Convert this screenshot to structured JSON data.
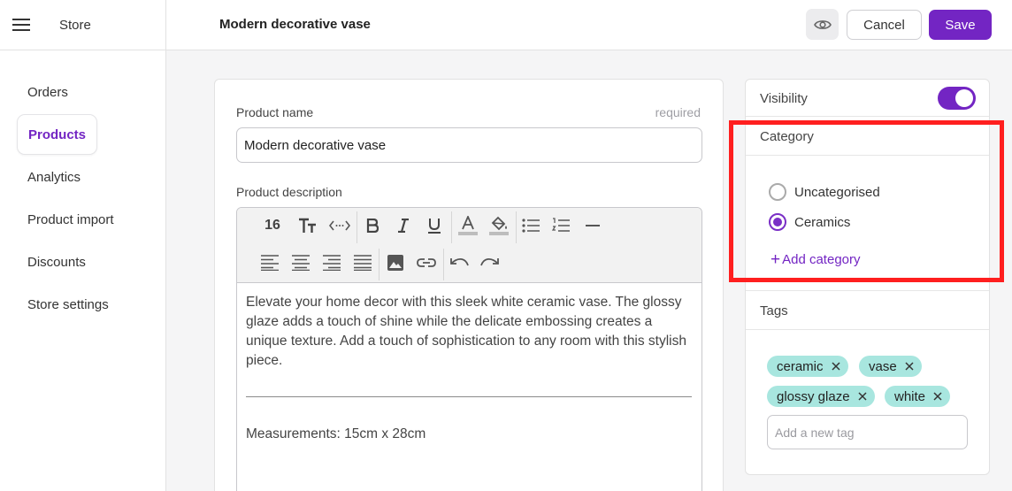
{
  "header": {
    "store_label": "Store",
    "page_title": "Modern decorative vase",
    "cancel_label": "Cancel",
    "save_label": "Save"
  },
  "sidebar": {
    "items": [
      {
        "label": "Orders",
        "active": false
      },
      {
        "label": "Products",
        "active": true
      },
      {
        "label": "Analytics",
        "active": false
      },
      {
        "label": "Product import",
        "active": false
      },
      {
        "label": "Discounts",
        "active": false
      },
      {
        "label": "Store settings",
        "active": false
      }
    ]
  },
  "form": {
    "product_name_label": "Product name",
    "required_hint": "required",
    "product_name_value": "Modern decorative vase",
    "description_label": "Product description",
    "toolbar": {
      "font_size": "16",
      "icons": [
        "text-size-icon",
        "code-icon",
        "bold-icon",
        "italic-icon",
        "underline-icon",
        "text-color-icon",
        "highlight-color-icon",
        "bullet-list-icon",
        "numbered-list-icon",
        "horizontal-rule-icon",
        "align-left-icon",
        "align-center-icon",
        "align-right-icon",
        "align-justify-icon",
        "image-icon",
        "link-icon",
        "undo-icon",
        "redo-icon"
      ]
    },
    "description_text": "Elevate your home decor with this sleek white ceramic vase. The glossy glaze adds a touch of shine while the delicate embossing creates a unique texture. Add a touch of sophistication to any room with this stylish piece.",
    "measurements_text": "Measurements: 15cm x 28cm"
  },
  "side_panel": {
    "visibility_label": "Visibility",
    "visibility_on": true,
    "category_label": "Category",
    "categories": [
      {
        "label": "Uncategorised",
        "selected": false
      },
      {
        "label": "Ceramics",
        "selected": true
      }
    ],
    "add_category_label": "Add category",
    "tags_label": "Tags",
    "tags": [
      "ceramic",
      "vase",
      "glossy glaze",
      "white"
    ],
    "tag_input_placeholder": "Add a new tag"
  },
  "colors": {
    "accent": "#7325c3",
    "tag_bg": "#a8e6df",
    "highlight": "#ff1f1f"
  }
}
